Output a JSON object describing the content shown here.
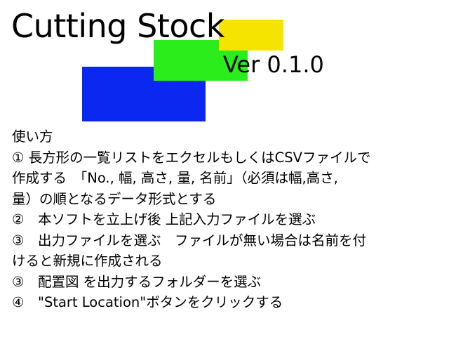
{
  "colors": {
    "background": "#ffffff",
    "blue": "#0a28ef",
    "green": "#2ced1c",
    "yellow": "#f5e400",
    "text": "#000000"
  },
  "header": {
    "title": "Cutting Stock",
    "version": "Ver 0.1.0"
  },
  "instructions": {
    "heading": "使い方",
    "lines": [
      "① 長方形の一覧リストをエクセルもしくはCSVファイルで",
      "作成する　「No., 幅, 高さ, 量, 名前」（必須は幅,高さ,",
      "量）の順となるデータ形式とする",
      "②　本ソフトを立上げ後 上記入力ファイルを選ぶ",
      "③　出力ファイルを選ぶ　ファイルが無い場合は名前を付",
      "けると新規に作成される",
      "③　配置図 を出力するフォルダーを選ぶ",
      "④　\"Start Location\"ボタンをクリックする"
    ]
  }
}
